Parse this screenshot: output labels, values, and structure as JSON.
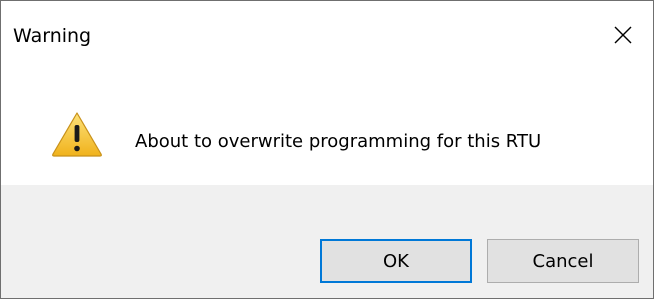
{
  "window": {
    "title": "Warning"
  },
  "message": {
    "text": "About to overwrite programming for this RTU",
    "icon": "warning-triangle-icon"
  },
  "buttons": {
    "ok_label": "OK",
    "cancel_label": "Cancel"
  },
  "colors": {
    "accent": "#0078d7",
    "footer_bg": "#f0f0f0",
    "button_bg": "#e1e1e1",
    "warning_yellow": "#f7c531"
  }
}
